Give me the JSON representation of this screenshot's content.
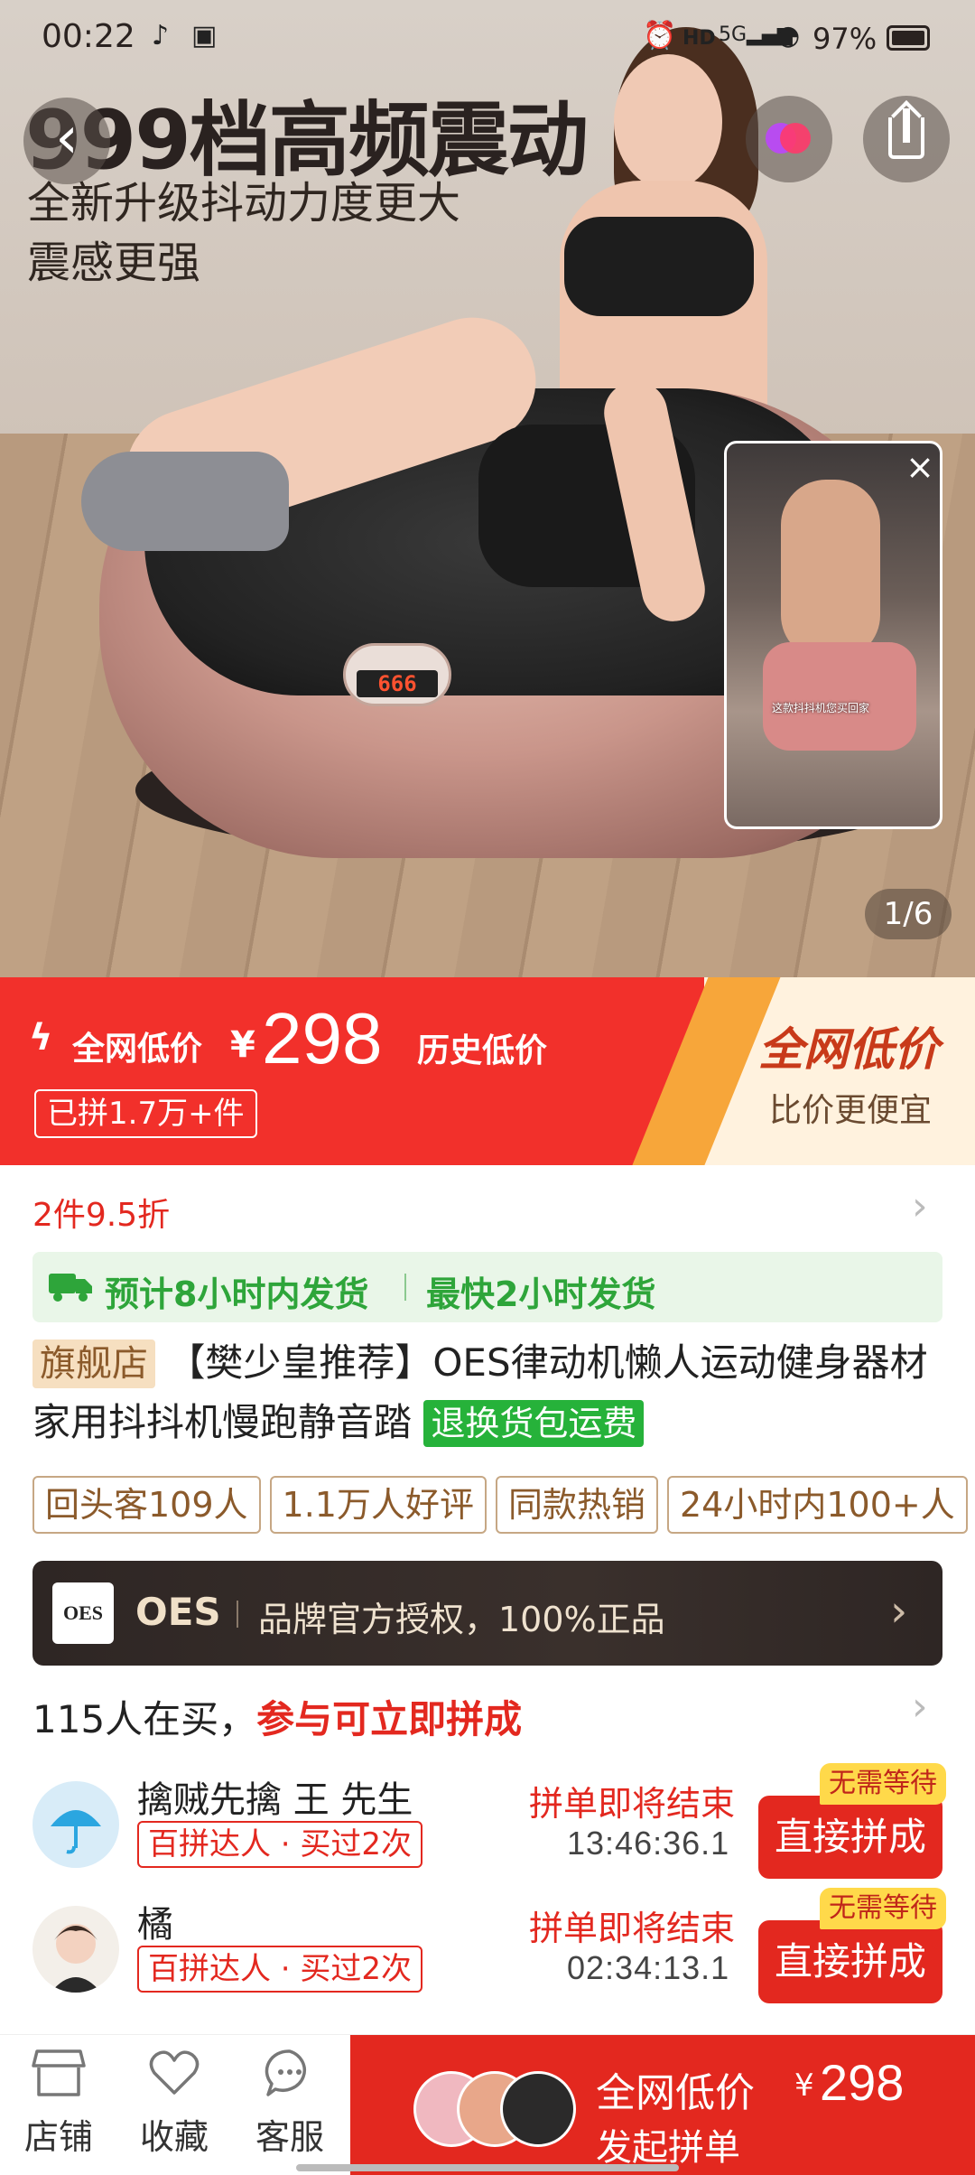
{
  "status_bar": {
    "time": "00:22",
    "battery": "97%"
  },
  "hero": {
    "headline": "999档高频震动",
    "subline1": "全新升级抖动力度更大",
    "subline2": "震感更强",
    "display_digits": "666",
    "video_caption": "这款抖抖机您买回家",
    "counter": "1/6"
  },
  "price_banner": {
    "low_label": "全网低价",
    "currency": "¥",
    "price": "298",
    "history_label": "历史低价",
    "sold": "已拼1.7万+件",
    "right_title": "全网低价",
    "right_sub": "比价更便宜"
  },
  "discount": "2件9.5折",
  "shipping": {
    "estimate": "预计8小时内发货",
    "fastest": "最快2小时发货"
  },
  "product": {
    "store_flag": "旗舰店",
    "title": "【樊少皇推荐】OES律动机懒人运动健身器材家用抖抖机慢跑静音踏",
    "return_tag": "退换货包运费"
  },
  "tags": [
    "回头客109人",
    "1.1万人好评",
    "同款热销",
    "24小时内100+人"
  ],
  "brand": {
    "logo": "OES",
    "name": "OES",
    "text": "品牌官方授权，100%正品"
  },
  "group_buy": {
    "count_text": "115人在买，",
    "highlight": "参与可立即拼成",
    "rows": [
      {
        "name": "擒贼先擒  王  先生",
        "badge": "百拼达人 · 买过2次",
        "end_label": "拼单即将结束",
        "time": "13:46:36.1",
        "button": "直接拼成",
        "no_wait": "无需等待"
      },
      {
        "name": "橘",
        "badge": "百拼达人 · 买过2次",
        "end_label": "拼单即将结束",
        "time": "02:34:13.1",
        "button": "直接拼成",
        "no_wait": "无需等待"
      }
    ]
  },
  "bottom_bar": {
    "store": "店铺",
    "favorite": "收藏",
    "service": "客服",
    "cta_label": "全网低价",
    "cta_currency": "¥",
    "cta_price": "298",
    "cta_action": "发起拼单"
  },
  "colors": {
    "brand_red": "#e3281f",
    "ship_green": "#2ea53a",
    "tag_gold": "#8b5a2b"
  }
}
